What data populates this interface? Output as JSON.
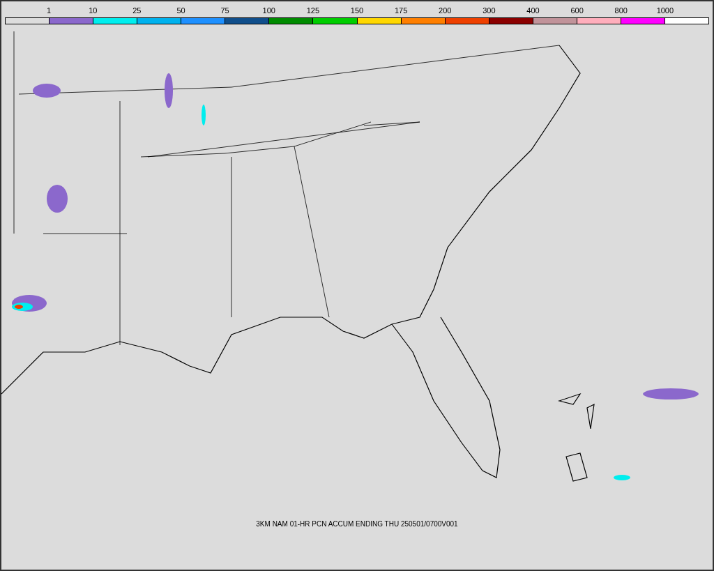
{
  "legend": {
    "bins": [
      {
        "color": "#dcdcdc",
        "label": "1"
      },
      {
        "color": "#8b68cc",
        "label": "10"
      },
      {
        "color": "#00eeee",
        "label": "25"
      },
      {
        "color": "#00b2ee",
        "label": "50"
      },
      {
        "color": "#1e90ff",
        "label": "75"
      },
      {
        "color": "#104e8b",
        "label": "100"
      },
      {
        "color": "#008b00",
        "label": "125"
      },
      {
        "color": "#00cd00",
        "label": "150"
      },
      {
        "color": "#ffd700",
        "label": "175"
      },
      {
        "color": "#ff7f00",
        "label": "200"
      },
      {
        "color": "#ee4000",
        "label": "300"
      },
      {
        "color": "#8b0000",
        "label": "400"
      },
      {
        "color": "#c1939a",
        "label": "600"
      },
      {
        "color": "#ffaebc",
        "label": "800"
      },
      {
        "color": "#ff00ff",
        "label": "1000"
      },
      {
        "color": "#ffffff"
      }
    ]
  },
  "caption": "3KM NAM 01-HR PCN ACCUM ENDING THU 250501/0700V001"
}
